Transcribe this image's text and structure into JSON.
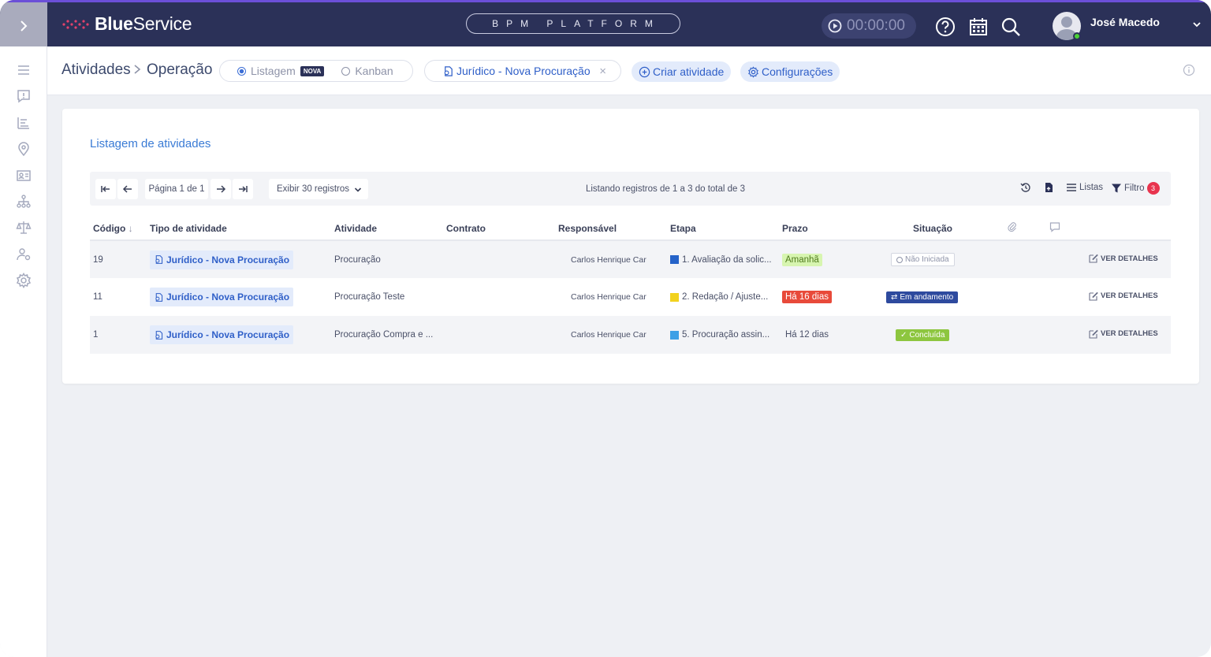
{
  "app": {
    "brand_bold": "Blue",
    "brand_light": "Service",
    "platform": "BPM PLATFORM",
    "timer": "00:00:00",
    "user_name": "José Macedo"
  },
  "subheader": {
    "breadcrumb_root": "Atividades",
    "breadcrumb_current": "Operação",
    "view_listagem": "Listagem",
    "view_badge": "NOVA",
    "view_kanban": "Kanban",
    "filter_chip": "Jurídico - Nova Procuração",
    "create_button": "Criar atividade",
    "settings_button": "Configurações"
  },
  "card": {
    "title": "Listagem de atividades",
    "page_label": "Página 1 de 1",
    "page_size": "Exibir 30 registros",
    "listing_text": "Listando registros de 1 a 3 do total de 3",
    "lists_label": "Listas",
    "filter_label": "Filtro",
    "filter_count": "3"
  },
  "table": {
    "headers": {
      "code": "Código",
      "type": "Tipo de atividade",
      "activity": "Atividade",
      "contract": "Contrato",
      "responsible": "Responsável",
      "stage": "Etapa",
      "due": "Prazo",
      "status": "Situação"
    },
    "rows": [
      {
        "code": "19",
        "type": "Jurídico - Nova Procuração",
        "activity": "Procuração",
        "contract": "",
        "responsible": "Carlos Henrique Car",
        "stage": "1. Avaliação da solic...",
        "stage_color": "#2563c9",
        "due": "Amanhã",
        "status": "Não Iniciada",
        "details": "VER DETALHES"
      },
      {
        "code": "11",
        "type": "Jurídico - Nova Procuração",
        "activity": "Procuração Teste",
        "contract": "",
        "responsible": "Carlos Henrique Car",
        "stage": "2. Redação / Ajuste...",
        "stage_color": "#f2d21e",
        "due": "Há 16 dias",
        "status": "Em andamento",
        "details": "VER DETALHES"
      },
      {
        "code": "1",
        "type": "Jurídico - Nova Procuração",
        "activity": "Procuração Compra e ...",
        "contract": "",
        "responsible": "Carlos Henrique Car",
        "stage": "5. Procuração assin...",
        "stage_color": "#3da0e6",
        "due": "Há 12 dias",
        "status": "Concluída",
        "details": "VER DETALHES"
      }
    ]
  },
  "colors": {
    "topbar": "#2b3158",
    "accent": "#2f5fc8",
    "due_soon": "#d7f5b0",
    "overdue": "#e84a3a",
    "in_progress": "#2e4a9e",
    "done": "#8dc63f"
  }
}
